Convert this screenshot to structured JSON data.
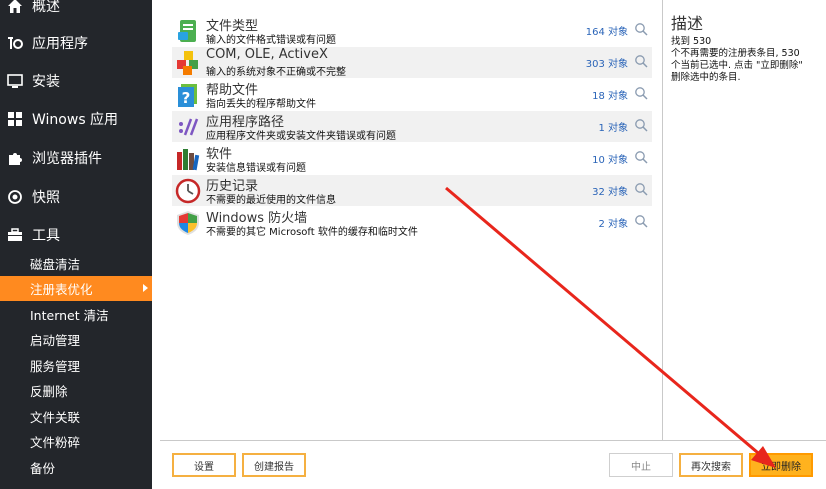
{
  "sidebar": {
    "items": [
      {
        "label": "概述",
        "icon": "home-icon"
      },
      {
        "label": "应用程序",
        "icon": "apps-icon"
      },
      {
        "label": "安装",
        "icon": "install-icon"
      },
      {
        "label": "Winows 应用",
        "icon": "windows-icon"
      },
      {
        "label": "浏览器插件",
        "icon": "puzzle-icon"
      },
      {
        "label": "快照",
        "icon": "snapshot-icon"
      },
      {
        "label": "工具",
        "icon": "toolbox-icon"
      }
    ],
    "sub_items": [
      {
        "label": "磁盘清洁"
      },
      {
        "label": "注册表优化",
        "active": true
      },
      {
        "label": "Internet 清洁"
      },
      {
        "label": "启动管理"
      },
      {
        "label": "服务管理"
      },
      {
        "label": "反删除"
      },
      {
        "label": "文件关联"
      },
      {
        "label": "文件粉碎"
      },
      {
        "label": "备份"
      }
    ]
  },
  "list": {
    "rows": [
      {
        "title": "文件类型",
        "desc": "输入的文件格式错误或有问题",
        "count": "164 对象"
      },
      {
        "title": "COM, OLE, ActiveX",
        "desc": "输入的系统对象不正确或不完整",
        "count": "303 对象"
      },
      {
        "title": "帮助文件",
        "desc": "指向丢失的程序帮助文件",
        "count": "18 对象"
      },
      {
        "title": "应用程序路径",
        "desc": "应用程序文件夹或安装文件夹错误或有问题",
        "count": "1 对象"
      },
      {
        "title": "软件",
        "desc": "安装信息错误或有问题",
        "count": "10 对象"
      },
      {
        "title": "历史记录",
        "desc": "不需要的最近使用的文件信息",
        "count": "32 对象"
      },
      {
        "title": "Windows 防火墙",
        "desc": "不需要的其它 Microsoft 软件的缓存和临时文件",
        "count": "2 对象"
      }
    ]
  },
  "description": {
    "title": "描述",
    "lines": [
      "找到 530",
      "个不再需要的注册表条目, 530",
      "个当前已选中. 点击 \"立即删除\"",
      "删除选中的条目."
    ]
  },
  "buttons": {
    "settings": "设置",
    "create_report": "创建报告",
    "stop": "中止",
    "search_again": "再次搜索",
    "delete_now": "立即删除"
  },
  "colors": {
    "sidebar_bg": "#23262b",
    "accent": "#ff8a1f",
    "count_text": "#2a64b8",
    "annotation": "#e8261c"
  }
}
